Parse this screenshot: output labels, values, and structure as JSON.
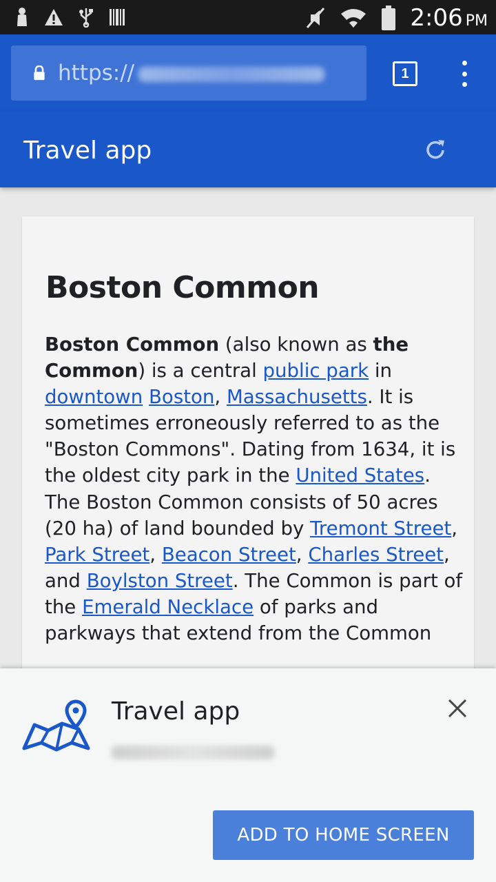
{
  "status_bar": {
    "time": "2:06",
    "ampm": "PM",
    "icons": [
      "notification-icon",
      "warning-icon",
      "usb-icon",
      "barcode-icon",
      "mute-icon",
      "wifi-icon",
      "battery-icon"
    ]
  },
  "browser": {
    "url_prefix": "https://",
    "tab_count": "1"
  },
  "app_bar": {
    "title": "Travel app"
  },
  "article": {
    "title": "Boston Common",
    "p1_bold1": "Boston Common",
    "p1_t1": " (also known as ",
    "p1_bold2": "the Common",
    "p1_t2": ") is a central ",
    "link_public_park": "public park",
    "p1_t3": " in ",
    "link_downtown": "downtown",
    "p1_t4": " ",
    "link_boston": "Boston",
    "p1_t5": ", ",
    "link_massachusetts": "Massachusetts",
    "p1_t6": ". It is sometimes erroneously referred to as the \"Boston Commons\". Dating from 1634, it is the oldest city park in the ",
    "link_united_states": "United States",
    "p1_t7": ". The Boston Common consists of 50 acres (20 ha) of land bounded by ",
    "link_tremont": "Tremont Street",
    "p1_t8": ", ",
    "link_park_street": "Park Street",
    "p1_t9": ", ",
    "link_beacon": "Beacon Street",
    "p1_t10": ", ",
    "link_charles": "Charles Street",
    "p1_t11": ", and ",
    "link_boylston": "Boylston Street",
    "p1_t12": ". The Common is part of the ",
    "link_emerald": "Emerald Necklace",
    "p1_t13": " of parks and parkways that extend from the Common"
  },
  "install_sheet": {
    "title": "Travel app",
    "button_label": "ADD TO HOME SCREEN"
  },
  "colors": {
    "brand_blue": "#1a57c9",
    "link_blue": "#1a57c9",
    "button_blue": "#4a80d9"
  }
}
